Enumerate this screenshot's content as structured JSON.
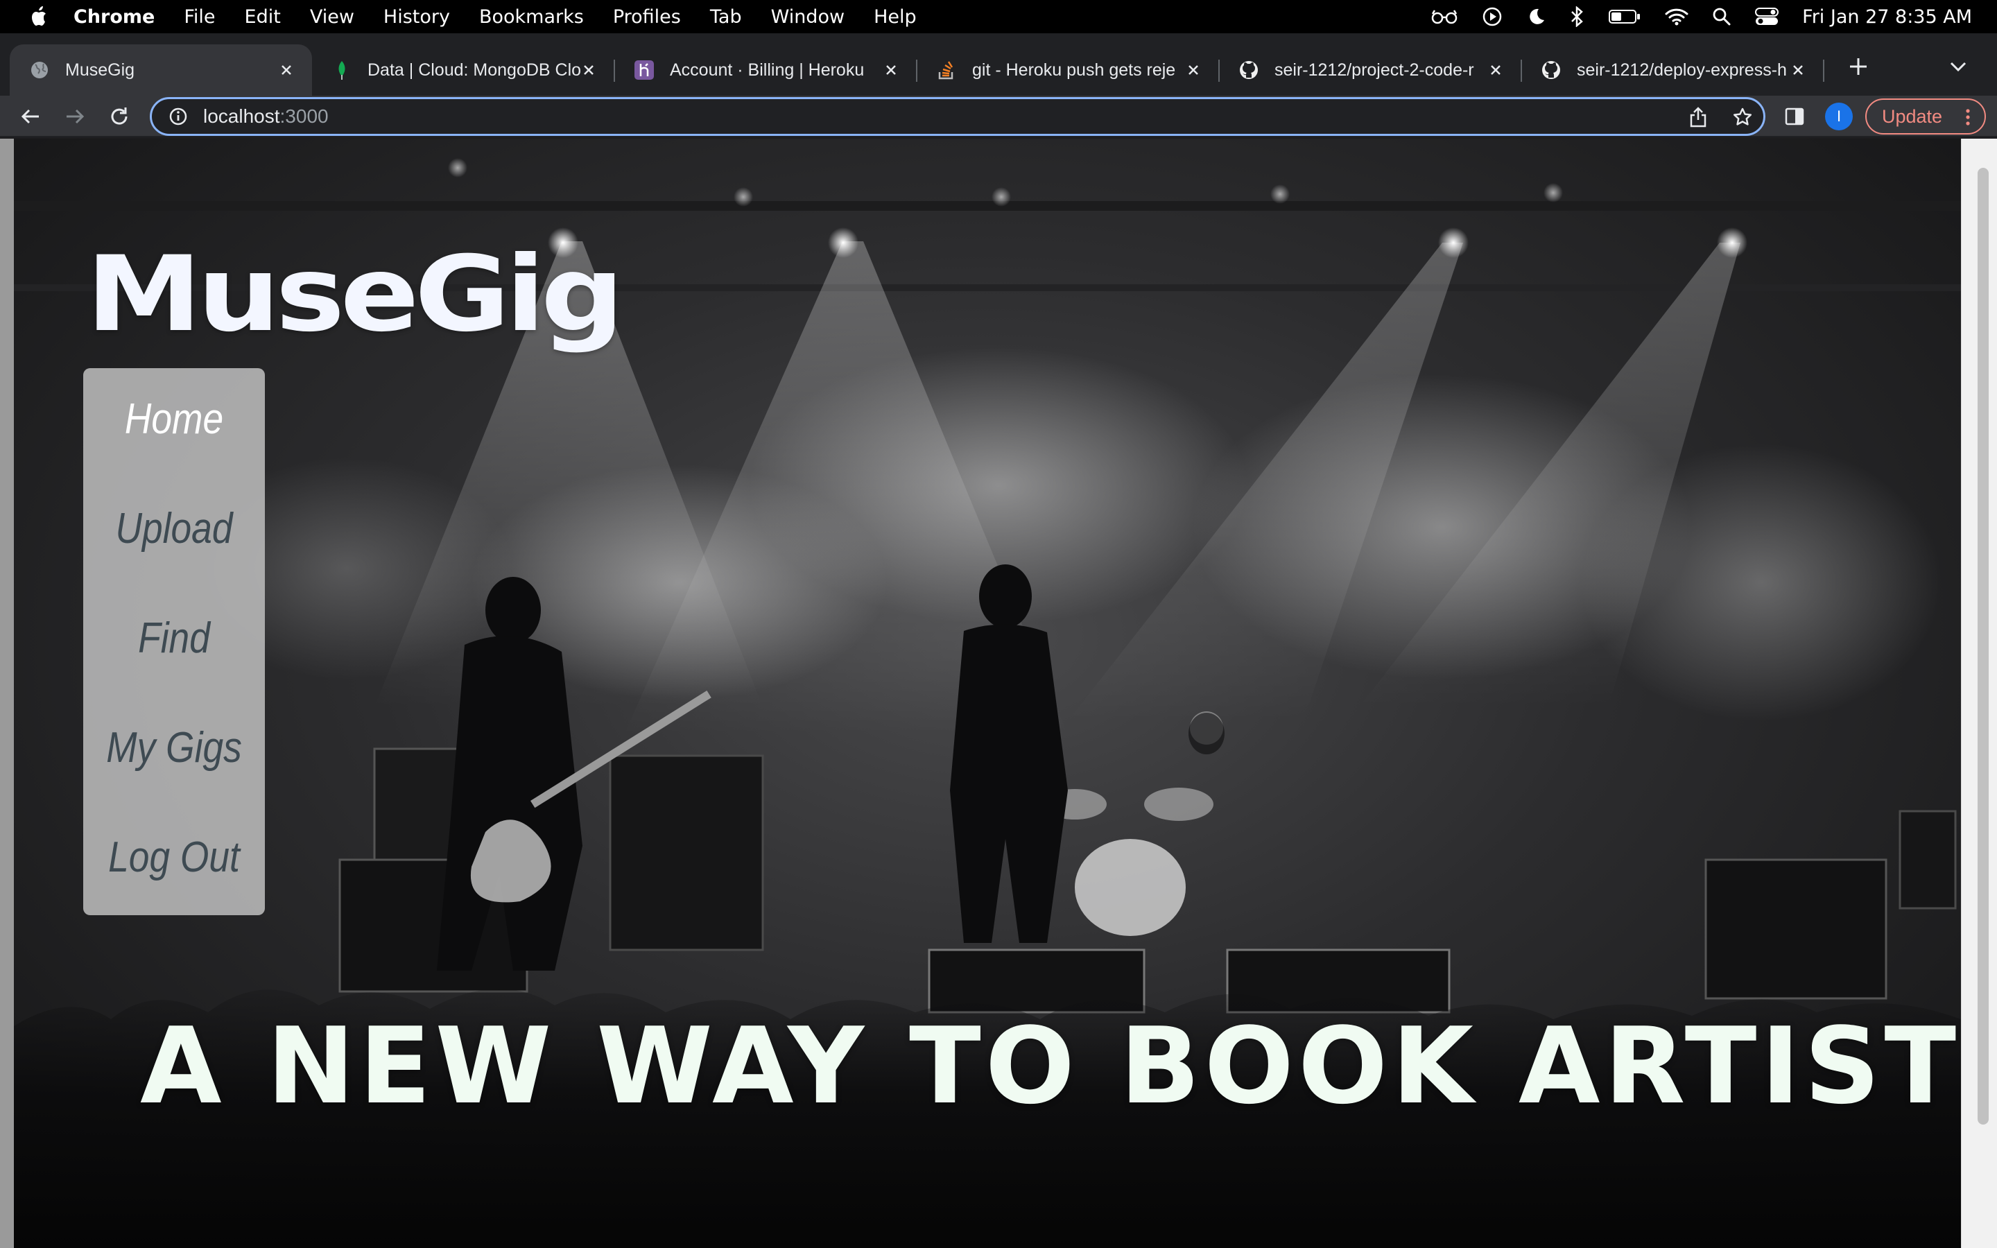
{
  "menubar": {
    "app_name": "Chrome",
    "items": [
      "File",
      "Edit",
      "View",
      "History",
      "Bookmarks",
      "Profiles",
      "Tab",
      "Window",
      "Help"
    ],
    "status_icons": [
      "glasses-icon",
      "play-circle-icon",
      "moon-icon",
      "bluetooth-icon",
      "battery-icon",
      "wifi-icon",
      "search-icon",
      "control-center-icon"
    ],
    "clock": "Fri Jan 27  8:35 AM"
  },
  "tabs": [
    {
      "title": "MuseGig",
      "icon": "globe-icon",
      "active": true
    },
    {
      "title": "Data | Cloud: MongoDB Clo",
      "icon": "mongodb-leaf-icon",
      "active": false
    },
    {
      "title": "Account · Billing | Heroku",
      "icon": "heroku-icon",
      "active": false
    },
    {
      "title": "git - Heroku push gets reje",
      "icon": "stackoverflow-icon",
      "active": false
    },
    {
      "title": "seir-1212/project-2-code-r",
      "icon": "github-icon",
      "active": false
    },
    {
      "title": "seir-1212/deploy-express-h",
      "icon": "github-icon",
      "active": false
    }
  ],
  "toolbar": {
    "url_host": "localhost",
    "url_port": ":3000",
    "profile_initial": "I",
    "update_label": "Update"
  },
  "page": {
    "brand": "MuseGig",
    "nav": [
      "Home",
      "Upload",
      "Find",
      "My Gigs",
      "Log Out"
    ],
    "active_nav": "Home",
    "tagline": "A NEW WAY TO BOOK ARTISTS"
  },
  "colors": {
    "accent_focus": "#8ab4f8",
    "update_button": "#f28b82",
    "nav_panel": "#b4b4b4",
    "nav_text": "#3e4a52",
    "tagline": "#f0fbf2"
  }
}
